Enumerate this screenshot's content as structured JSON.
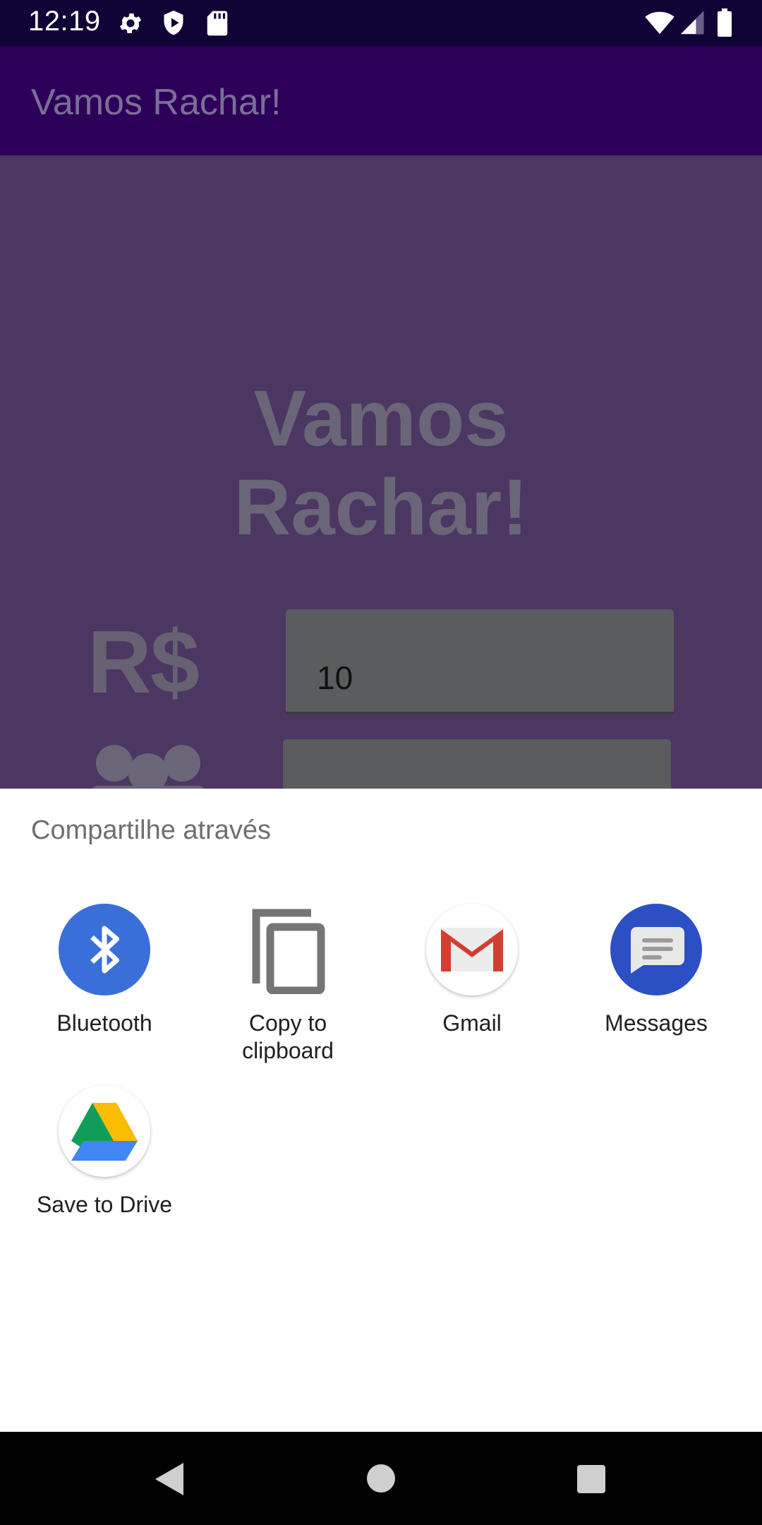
{
  "status_bar": {
    "time": "12:19",
    "left_icons": [
      "gear-icon",
      "shield-play-icon",
      "sd-card-icon"
    ],
    "right_icons": [
      "wifi-icon",
      "cell-signal-icon",
      "battery-icon"
    ]
  },
  "app_bar": {
    "title": "Vamos Rachar!"
  },
  "main": {
    "headline_line1": "Vamos",
    "headline_line2": "Rachar!",
    "currency_label": "R$",
    "amount_value": "10",
    "people_icon": "people-icon"
  },
  "share_sheet": {
    "title": "Compartilhe através",
    "targets": [
      {
        "label": "Bluetooth",
        "icon": "bluetooth-icon"
      },
      {
        "label_line1": "Copy to",
        "label_line2": "clipboard",
        "icon": "copy-icon"
      },
      {
        "label": "Gmail",
        "icon": "gmail-icon"
      },
      {
        "label": "Messages",
        "icon": "messages-icon"
      },
      {
        "label": "Save to Drive",
        "icon": "drive-icon"
      }
    ]
  },
  "nav_bar": {
    "buttons": [
      "back-button",
      "home-button",
      "recents-button"
    ]
  },
  "colors": {
    "status_bar": "#100436",
    "app_bar": "#2c0059",
    "content_scrim": "#4b3762",
    "sheet_bg": "#ffffff",
    "bluetooth_blue": "#3a6ed8",
    "messages_blue": "#2c4fc4"
  }
}
